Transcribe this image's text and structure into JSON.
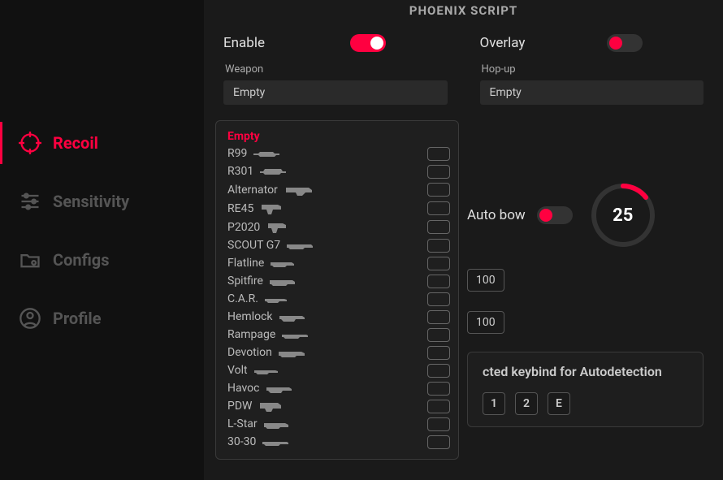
{
  "app": {
    "title": "PHOENIX SCRIPT"
  },
  "sidebar": {
    "items": [
      {
        "name": "recoil",
        "label": "Recoil",
        "active": true
      },
      {
        "name": "sensitivity",
        "label": "Sensitivity",
        "active": false
      },
      {
        "name": "configs",
        "label": "Configs",
        "active": false
      },
      {
        "name": "profile",
        "label": "Profile",
        "active": false
      }
    ]
  },
  "main": {
    "enable": {
      "label": "Enable",
      "on": true
    },
    "overlay": {
      "label": "Overlay",
      "on": false
    },
    "weapon": {
      "label": "Weapon",
      "value": "Empty"
    },
    "hopup": {
      "label": "Hop-up",
      "value": "Empty"
    },
    "autobow": {
      "label": "Auto bow",
      "on": false,
      "value": "25"
    },
    "num1": "100",
    "num2": "100",
    "keybind": {
      "title": "cted keybind for Autodetection",
      "keys": [
        "1",
        "2",
        "E"
      ]
    }
  },
  "weapon_dropdown": {
    "selected": "Empty",
    "items": [
      "Empty",
      "R99",
      "R301",
      "Alternator",
      "RE45",
      "P2020",
      "SCOUT G7",
      "Flatline",
      "Spitfire",
      "C.A.R.",
      "Hemlock",
      "Rampage",
      "Devotion",
      "Volt",
      "Havoc",
      "PDW",
      "L-Star",
      "30-30"
    ]
  }
}
